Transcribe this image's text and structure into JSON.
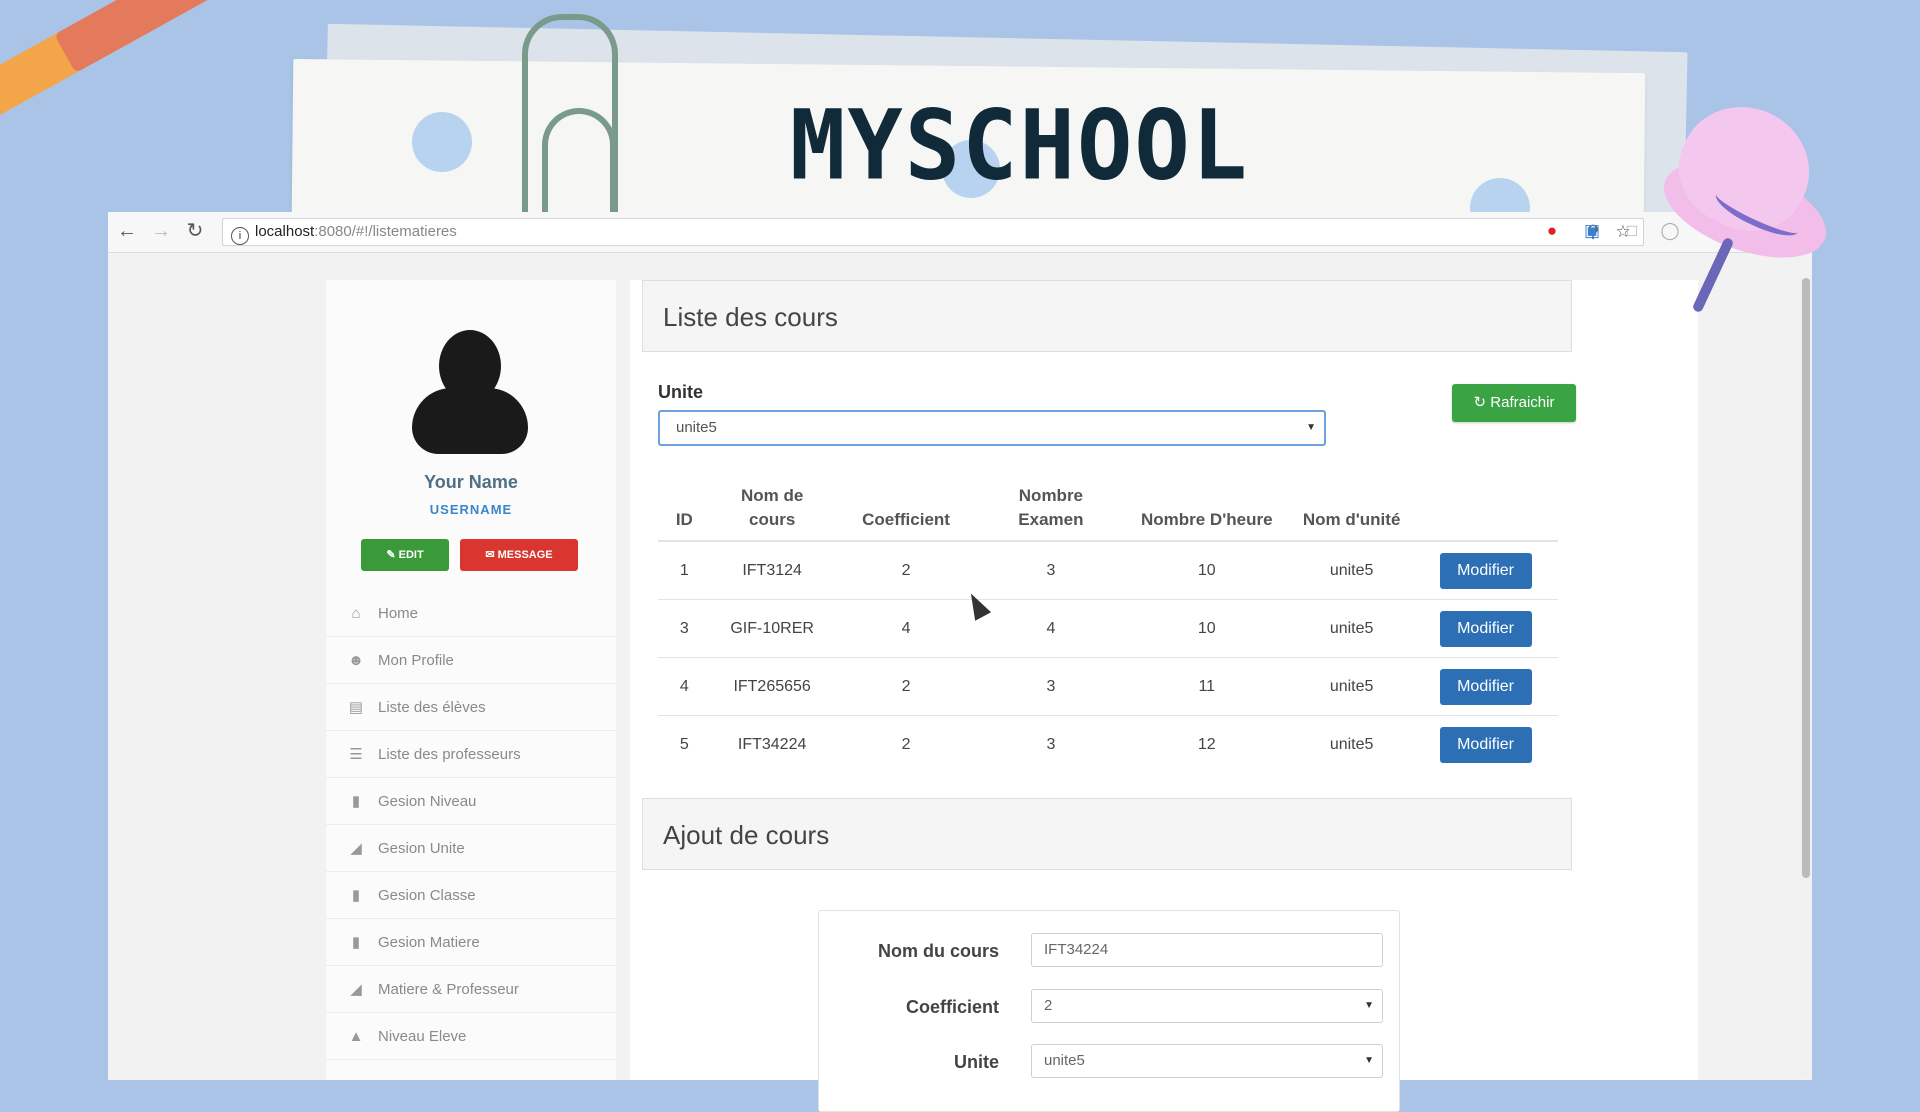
{
  "brand": {
    "title": "MYSCHOOL"
  },
  "browser": {
    "url_host": "localhost",
    "url_path": ":8080/#!/listematieres"
  },
  "sidebar": {
    "name": "Your Name",
    "username": "USERNAME",
    "edit_label": "EDIT",
    "message_label": "MESSAGE",
    "items": [
      {
        "label": "Home",
        "icon": "home-icon"
      },
      {
        "label": "Mon Profile",
        "icon": "user-icon"
      },
      {
        "label": "Liste des élèves",
        "icon": "list-icon"
      },
      {
        "label": "Liste des professeurs",
        "icon": "list-icon"
      },
      {
        "label": "Gesion Niveau",
        "icon": "bar-chart-icon"
      },
      {
        "label": "Gesion Unite",
        "icon": "signal-icon"
      },
      {
        "label": "Gesion Classe",
        "icon": "bar-chart-icon"
      },
      {
        "label": "Gesion Matiere",
        "icon": "bar-chart-icon"
      },
      {
        "label": "Matiere & Professeur",
        "icon": "signal-icon"
      },
      {
        "label": "Niveau Eleve",
        "icon": "graduation-icon"
      }
    ]
  },
  "main": {
    "list_title": "Liste des cours",
    "unite_label": "Unite",
    "unite_value": "unite5",
    "refresh_label": "Rafraichir",
    "columns": [
      "ID",
      "Nom de cours",
      "Coefficient",
      "Nombre Examen",
      "Nombre D'heure",
      "Nom d'unité"
    ],
    "rows": [
      {
        "id": "1",
        "nom": "IFT3124",
        "coef": "2",
        "examen": "3",
        "heure": "10",
        "unite": "unite5",
        "action": "Modifier"
      },
      {
        "id": "3",
        "nom": "GIF-10RER",
        "coef": "4",
        "examen": "4",
        "heure": "10",
        "unite": "unite5",
        "action": "Modifier"
      },
      {
        "id": "4",
        "nom": "IFT265656",
        "coef": "2",
        "examen": "3",
        "heure": "11",
        "unite": "unite5",
        "action": "Modifier"
      },
      {
        "id": "5",
        "nom": "IFT34224",
        "coef": "2",
        "examen": "3",
        "heure": "12",
        "unite": "unite5",
        "action": "Modifier"
      }
    ],
    "add_title": "Ajout de cours",
    "form": {
      "nom_label": "Nom du cours",
      "nom_value": "IFT34224",
      "coef_label": "Coefficient",
      "coef_value": "2",
      "unite_label": "Unite",
      "unite_value": "unite5"
    }
  },
  "colors": {
    "background": "#a9c4e6",
    "edit_button": "#3a9a3a",
    "message_button": "#d9362f",
    "refresh_button": "#3aa344",
    "modify_button": "#2c6fb4"
  }
}
